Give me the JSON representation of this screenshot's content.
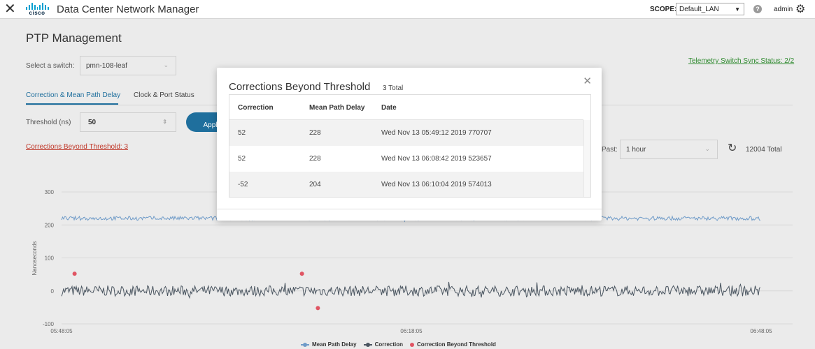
{
  "app": {
    "title": "Data Center Network Manager",
    "logo_text": "cisco",
    "scope_label": "SCOPE:",
    "scope_value": "Default_LAN",
    "user": "admin"
  },
  "page": {
    "title": "PTP Management",
    "switch_label": "Select a switch:",
    "switch_value": "pmn-108-leaf",
    "sync_status": "Telemetry Switch Sync Status: 2/2",
    "tabs": [
      {
        "label": "Correction & Mean Path Delay",
        "active": true
      },
      {
        "label": "Clock & Port Status",
        "active": false
      }
    ],
    "threshold_label": "Threshold (ns)",
    "threshold_value": "50",
    "apply_label": "Apply",
    "beyond_link": "Corrections Beyond Threshold: 3",
    "past_label": "Past:",
    "past_value": "1 hour",
    "total": "12004 Total"
  },
  "modal": {
    "title": "Corrections Beyond Threshold",
    "count": "3 Total",
    "columns": [
      "Correction",
      "Mean Path Delay",
      "Date"
    ],
    "rows": [
      [
        "52",
        "228",
        "Wed Nov 13 05:49:12 2019 770707"
      ],
      [
        "52",
        "228",
        "Wed Nov 13 06:08:42 2019 523657"
      ],
      [
        "-52",
        "204",
        "Wed Nov 13 06:10:04 2019 574013"
      ]
    ]
  },
  "chart_data": {
    "type": "line",
    "ylabel": "Nanoseconds",
    "yticks": [
      "300",
      "200",
      "100",
      "0",
      "-100"
    ],
    "ylim": [
      -100,
      300
    ],
    "xticks": [
      "05:48:05",
      "06:18:05",
      "06:48:05"
    ],
    "series": [
      {
        "name": "Mean Path Delay",
        "color": "#6f9bc8",
        "approx_level": 220
      },
      {
        "name": "Correction",
        "color": "#4a5560",
        "approx_level": 0
      },
      {
        "name": "Correction Beyond Threshold",
        "color": "#e05563",
        "points": [
          {
            "x": "05:49:12",
            "y": 52
          },
          {
            "x": "06:08:42",
            "y": 52
          },
          {
            "x": "06:10:04",
            "y": -52
          }
        ]
      }
    ],
    "grid": true,
    "legend": "bottom-center"
  }
}
